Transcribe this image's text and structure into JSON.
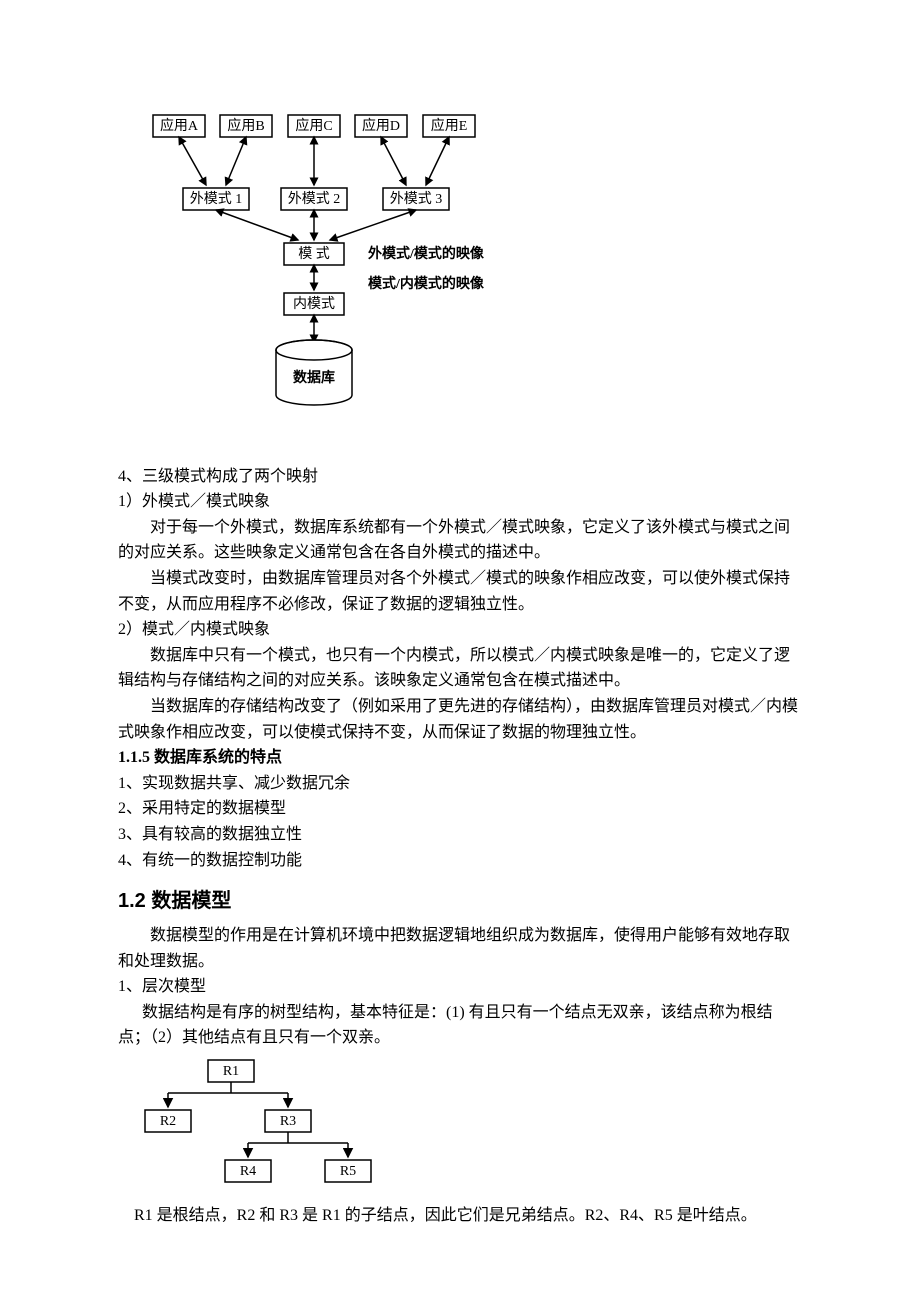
{
  "diagram1": {
    "apps": [
      "应用A",
      "应用B",
      "应用C",
      "应用D",
      "应用E"
    ],
    "ext": [
      "外模式 1",
      "外模式 2",
      "外模式 3"
    ],
    "schema": "模 式",
    "internal": "内模式",
    "db": "数据库",
    "note1": "外模式/模式的映像",
    "note2": "模式/内模式的映像"
  },
  "body": {
    "l4": "4、三级模式构成了两个映射",
    "l4_1": "1）外模式／模式映象",
    "p1": "对于每一个外模式，数据库系统都有一个外模式／模式映象，它定义了该外模式与模式之间的对应关系。这些映象定义通常包含在各自外模式的描述中。",
    "p2": "当模式改变时，由数据库管理员对各个外模式／模式的映象作相应改变，可以使外模式保持不变，从而应用程序不必修改，保证了数据的逻辑独立性。",
    "l4_2": "2）模式／内模式映象",
    "p3": "数据库中只有一个模式，也只有一个内模式，所以模式／内模式映象是唯一的，它定义了逻辑结构与存储结构之间的对应关系。该映象定义通常包含在模式描述中。",
    "p4": "当数据库的存储结构改变了（例如采用了更先进的存储结构），由数据库管理员对模式／内模式映象作相应改变，可以使模式保持不变，从而保证了数据的物理独立性。",
    "h115": "1.1.5  数据库系统的特点",
    "f1": "1、实现数据共享、减少数据冗余",
    "f2": "2、采用特定的数据模型",
    "f3": "3、具有较高的数据独立性",
    "f4": "4、有统一的数据控制功能",
    "h12": "1.2 数据模型",
    "p5": "数据模型的作用是在计算机环境中把数据逻辑地组织成为数据库，使得用户能够有效地存取和处理数据。",
    "m1": "1、层次模型",
    "p6": "数据结构是有序的树型结构，基本特征是：(1) 有且只有一个结点无双亲，该结点称为根结点；（2）其他结点有且只有一个双亲。",
    "cap": "R1 是根结点，R2 和 R3 是 R1 的子结点，因此它们是兄弟结点。R2、R4、R5 是叶结点。"
  },
  "diagram2": {
    "nodes": [
      "R1",
      "R2",
      "R3",
      "R4",
      "R5"
    ]
  }
}
